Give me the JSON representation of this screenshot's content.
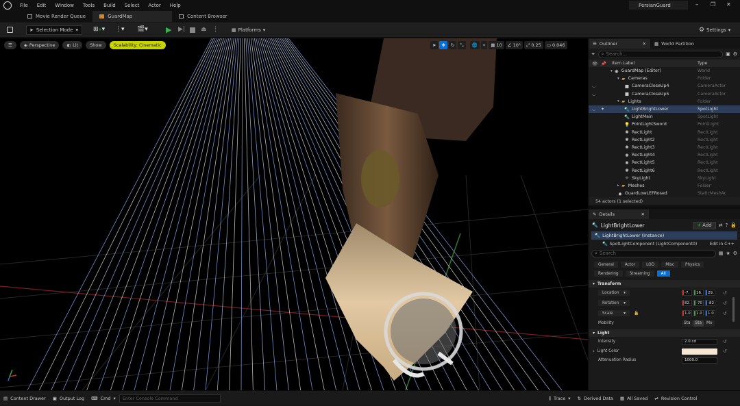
{
  "menubar": {
    "items": [
      "File",
      "Edit",
      "Window",
      "Tools",
      "Build",
      "Select",
      "Actor",
      "Help"
    ],
    "project_name": "PersianGuard"
  },
  "tabs": [
    {
      "label": "Movie Render Queue",
      "active": false
    },
    {
      "label": "GuardMap",
      "active": true
    },
    {
      "label": "Content Browser",
      "active": false
    }
  ],
  "toolbar": {
    "selection_mode": "Selection Mode",
    "platforms": "Platforms",
    "settings": "Settings"
  },
  "viewport": {
    "perspective": "Perspective",
    "lit": "Lit",
    "show": "Show",
    "scalability": "Scalability: Cinematic",
    "grid_snap": "10",
    "rotation_snap": "10°",
    "scale_snap": "0.25",
    "camera_speed": "0.046"
  },
  "outliner": {
    "tab_label": "Outliner",
    "world_partition_tab": "World Partition",
    "search_placeholder": "Search...",
    "col_label": "Item Label",
    "col_type": "Type",
    "items": [
      {
        "label": "GuardMap (Editor)",
        "type": "World",
        "indent": 1,
        "icon": "world"
      },
      {
        "label": "Cameras",
        "type": "Folder",
        "indent": 2,
        "icon": "folder"
      },
      {
        "label": "CameraCloseUp4",
        "type": "CameraActor",
        "indent": 3,
        "icon": "camera"
      },
      {
        "label": "CameraCloseUp5",
        "type": "CameraActor",
        "indent": 3,
        "icon": "camera"
      },
      {
        "label": "Lights",
        "type": "Folder",
        "indent": 2,
        "icon": "folder"
      },
      {
        "label": "LightBrightLower",
        "type": "SpotLight",
        "indent": 3,
        "icon": "spot",
        "selected": true
      },
      {
        "label": "LightMain",
        "type": "SpotLight",
        "indent": 3,
        "icon": "spot"
      },
      {
        "label": "PointLightSword",
        "type": "PointLight",
        "indent": 3,
        "icon": "point"
      },
      {
        "label": "RectLight",
        "type": "RectLight",
        "indent": 3,
        "icon": "rect"
      },
      {
        "label": "RectLight2",
        "type": "RectLight",
        "indent": 3,
        "icon": "rect"
      },
      {
        "label": "RectLight3",
        "type": "RectLight",
        "indent": 3,
        "icon": "rect"
      },
      {
        "label": "RectLight4",
        "type": "RectLight",
        "indent": 3,
        "icon": "rect"
      },
      {
        "label": "RectLight5",
        "type": "RectLight",
        "indent": 3,
        "icon": "rect"
      },
      {
        "label": "RectLight6",
        "type": "RectLight",
        "indent": 3,
        "icon": "rect"
      },
      {
        "label": "SkyLight",
        "type": "SkyLight",
        "indent": 3,
        "icon": "sky"
      },
      {
        "label": "Meshes",
        "type": "Folder",
        "indent": 2,
        "icon": "folder"
      },
      {
        "label": "GuardLowLEFRosed",
        "type": "StaticMeshAc",
        "indent": 2,
        "icon": "mesh"
      }
    ],
    "actor_count": "54 actors (1 selected)"
  },
  "details": {
    "tab_label": "Details",
    "actor_name": "LightBrightLower",
    "add_label": "Add",
    "instance_label": "LightBrightLower (Instance)",
    "component_label": "SpotLightComponent (LightComponent0)",
    "edit_cpp": "Edit in C++",
    "search_placeholder": "Search",
    "categories": [
      "General",
      "Actor",
      "LOD",
      "Misc",
      "Physics",
      "Rendering",
      "Streaming",
      "All"
    ],
    "active_category": "All",
    "transform_header": "Transform",
    "location_label": "Location",
    "location": [
      "-7.",
      "16.",
      "29."
    ],
    "rotation_label": "Rotation",
    "rotation": [
      "82.",
      "-70",
      "-82"
    ],
    "scale_label": "Scale",
    "scale": [
      "1.0",
      "1.0",
      "1.0"
    ],
    "mobility_label": "Mobility",
    "mobility_options": [
      "Sta",
      "Sta",
      "Mo"
    ],
    "light_header": "Light",
    "intensity_label": "Intensity",
    "intensity": "2.0 cd",
    "light_color_label": "Light Color",
    "light_color": "#f6e6d2",
    "attenuation_label": "Attenuation Radius",
    "attenuation": "1000.0"
  },
  "statusbar": {
    "content_drawer": "Content Drawer",
    "output_log": "Output Log",
    "cmd": "Cmd",
    "console_placeholder": "Enter Console Command",
    "trace": "Trace",
    "derived_data": "Derived Data",
    "all_saved": "All Saved",
    "revision_control": "Revision Control"
  },
  "colors": {
    "accent": "#0a6fd4",
    "scalability_bg": "#c8d400",
    "selection": "#2d3e5a",
    "play_green": "#37b24d"
  }
}
